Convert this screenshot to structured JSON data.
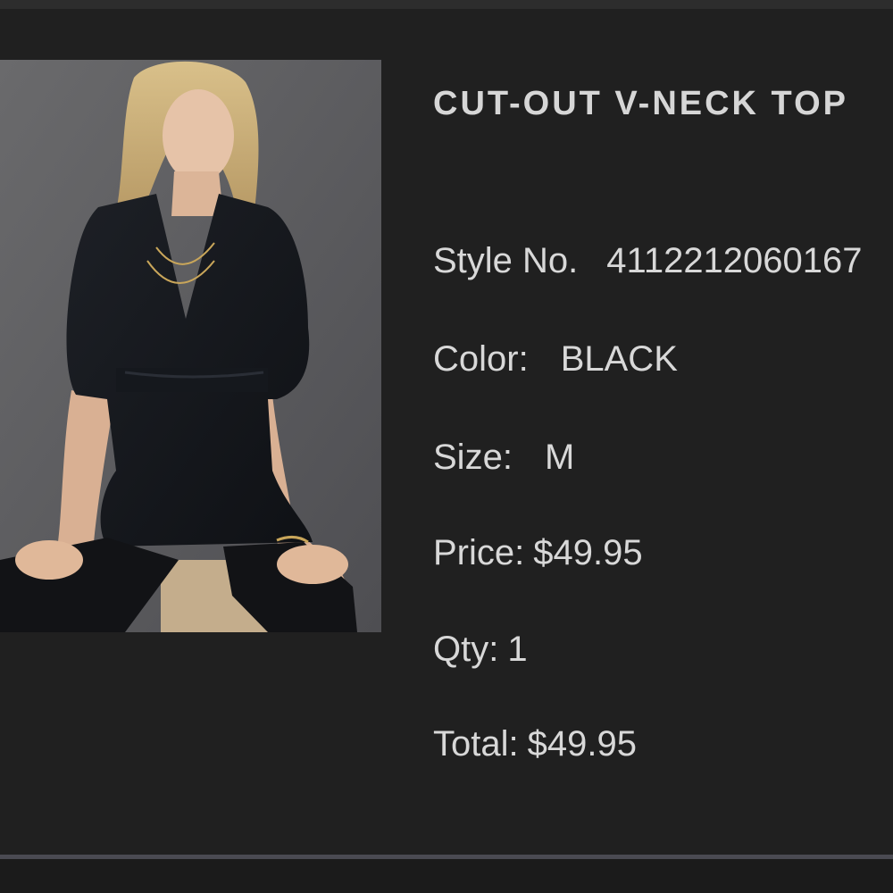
{
  "product": {
    "image_alt": "Model wearing black cut-out v-neck top",
    "title": "CUT-OUT V-NECK TOP"
  },
  "details": {
    "style_label": "Style No.",
    "style_value": "4112212060167",
    "color_label": "Color:",
    "color_value": "BLACK",
    "size_label": "Size:",
    "size_value": "M",
    "price_label": "Price:",
    "price_value": "$49.95",
    "qty_label": "Qty:",
    "qty_value": "1",
    "total_label": "Total:",
    "total_value": "$49.95"
  },
  "colors": {
    "background": "#202020",
    "text": "#d8d8d8",
    "divider": "#4a4a52"
  }
}
